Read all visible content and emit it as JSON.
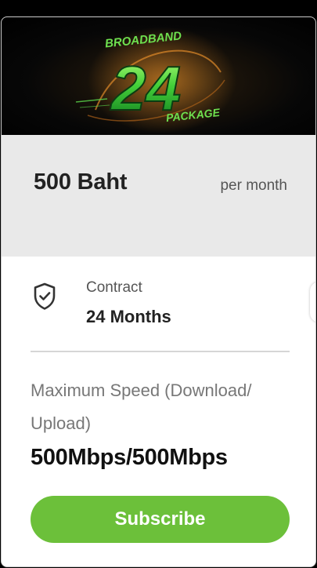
{
  "banner": {
    "brand_top": "BROADBAND",
    "brand_number": "24",
    "brand_bottom": "PACKAGE"
  },
  "price": {
    "amount": "500 Baht",
    "period": "per month"
  },
  "contract": {
    "icon": "shield-check-icon",
    "label": "Contract",
    "value": "24 Months"
  },
  "speed": {
    "label": "Maximum Speed (Download/ Upload)",
    "value": "500Mbps/500Mbps"
  },
  "actions": {
    "subscribe_label": "Subscribe"
  },
  "colors": {
    "accent": "#6cc03a",
    "price_panel_bg": "#e9e9e9",
    "banner_bg": "#000000",
    "brand_green": "#45d13a"
  }
}
